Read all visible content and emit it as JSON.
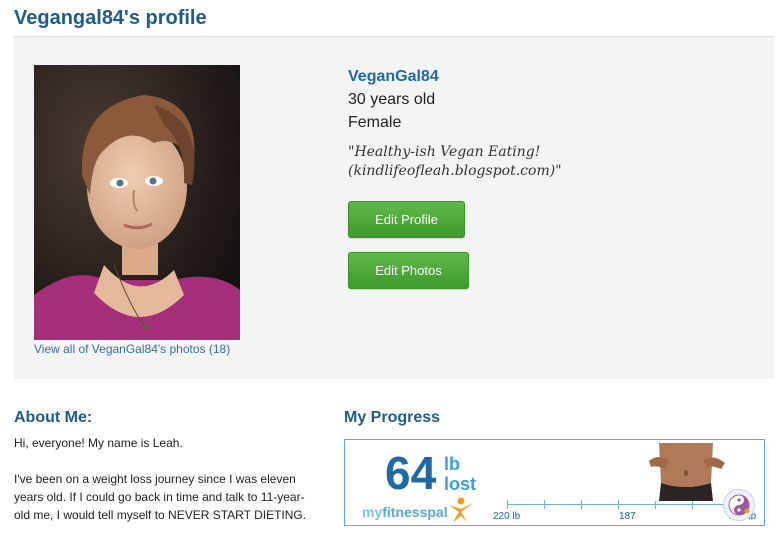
{
  "page": {
    "title": "Vegangal84's profile"
  },
  "profile": {
    "username": "VeganGal84",
    "age": "30 years old",
    "gender": "Female",
    "tagline": "\"Healthy-ish Vegan Eating! (kindlifeofleah.blogspot.com)\"",
    "view_photos_link": "View all of VeganGal84's photos (18)",
    "edit_profile_label": "Edit Profile",
    "edit_photos_label": "Edit Photos"
  },
  "about": {
    "heading": "About Me:",
    "paragraphs": [
      "Hi, everyone! My name is Leah.",
      "I've been on a weight loss journey since I was eleven years old. If I could go back in time and talk to 11-year-old me, I would tell myself to NEVER START DIETING."
    ]
  },
  "progress": {
    "heading": "My Progress",
    "lost_value": "64",
    "unit": "lb",
    "lost_label": "lost",
    "logo_my": "my",
    "logo_fitness": "fitnesspal",
    "scale_start": "220 lb",
    "scale_mid": "187",
    "scale_end": "154 lb"
  },
  "colors": {
    "heading_blue": "#1f5c8b",
    "link_blue": "#3a6fa8",
    "button_green": "#4caf38",
    "panel_gray": "#f4f4f4"
  }
}
